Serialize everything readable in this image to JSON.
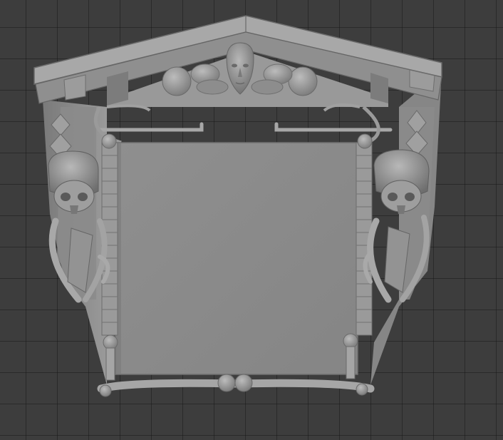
{
  "viewport": {
    "background": "#3d3d3d",
    "grid_color": "#2a2a2a"
  },
  "model": {
    "subject": "sculpted-gravestone-frame",
    "material_color": "#8e8e8e",
    "panel_color": "#8a8a8a",
    "highlight_color": "#b4b4b4",
    "shadow_color": "#5e5e5e"
  }
}
